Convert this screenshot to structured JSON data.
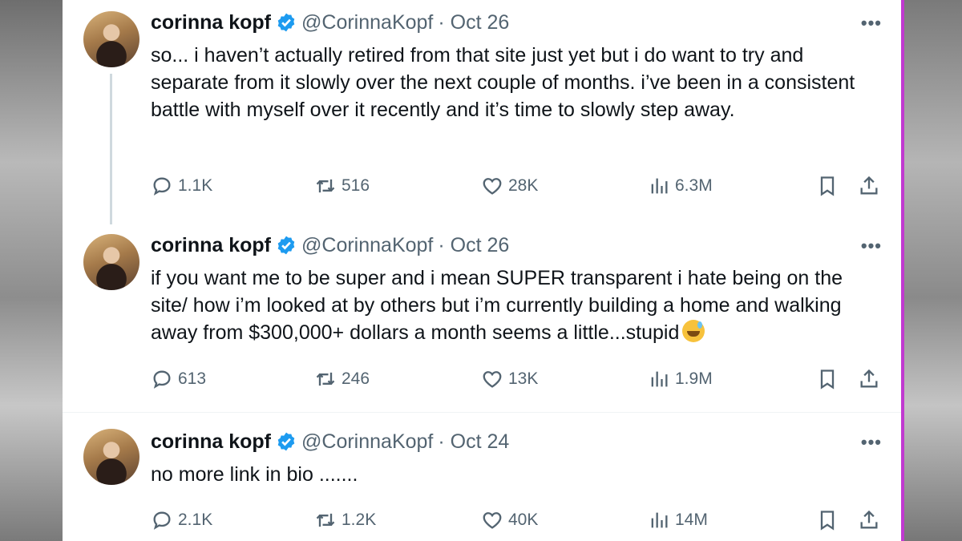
{
  "tweets": [
    {
      "name": "corinna kopf",
      "handle": "@CorinnaKopf",
      "date": "· Oct 26",
      "more": "•••",
      "text": "so... i haven’t actually retired from that site just yet but i do want to try and separate from it slowly over the next couple of months. i’ve been in a consistent battle with myself over it recently and it’s time to slowly step away.",
      "replies": "1.1K",
      "retweets": "516",
      "likes": "28K",
      "views": "6.3M"
    },
    {
      "name": "corinna kopf",
      "handle": "@CorinnaKopf",
      "date": "· Oct 26",
      "more": "•••",
      "text": "if you want me to be super and i mean SUPER transparent i hate being on the site/ how i’m looked at by others but i’m currently building a home and walking away from $300,000+ dollars a month seems a little...stupid",
      "emoji": "grinning-sweat-emoji",
      "replies": "613",
      "retweets": "246",
      "likes": "13K",
      "views": "1.9M"
    },
    {
      "name": "corinna kopf",
      "handle": "@CorinnaKopf",
      "date": "· Oct 24",
      "more": "•••",
      "text": "no more link in bio .......",
      "replies": "2.1K",
      "retweets": "1.2K",
      "likes": "40K",
      "views": "14M"
    }
  ],
  "colors": {
    "verified": "#1d9bf0",
    "text": "#0f1419",
    "secondary": "#536471",
    "thread_line": "#cfd9de",
    "right_border": "#c13ad0"
  }
}
